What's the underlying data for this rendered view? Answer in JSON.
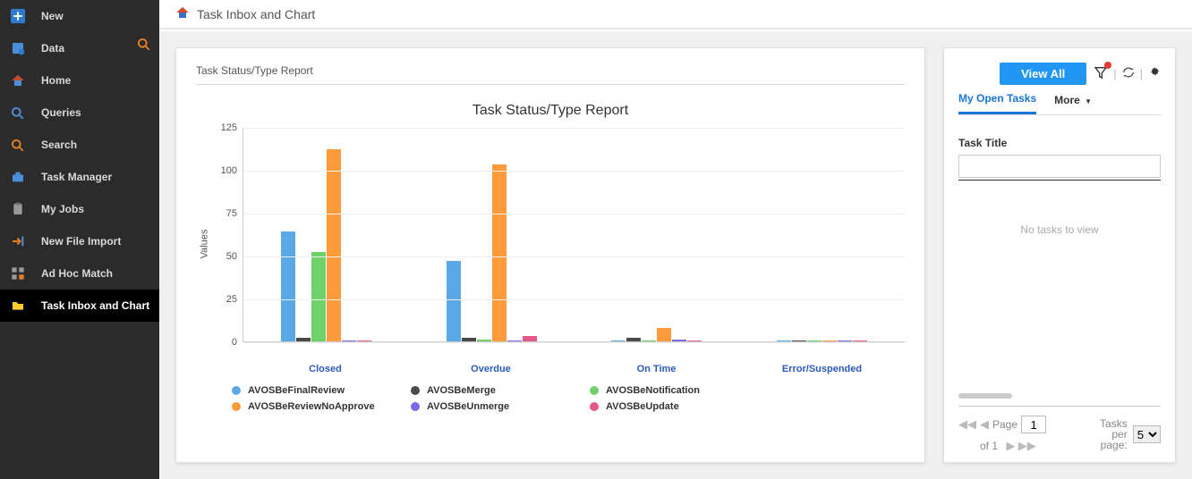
{
  "sidebar": {
    "items": [
      {
        "label": "New",
        "icon": "plus"
      },
      {
        "label": "Data",
        "icon": "data"
      },
      {
        "label": "Home",
        "icon": "home"
      },
      {
        "label": "Queries",
        "icon": "search-blue"
      },
      {
        "label": "Search",
        "icon": "search-orange"
      },
      {
        "label": "Task Manager",
        "icon": "briefcase"
      },
      {
        "label": "My Jobs",
        "icon": "clipboard"
      },
      {
        "label": "New File Import",
        "icon": "import"
      },
      {
        "label": "Ad Hoc Match",
        "icon": "grid"
      },
      {
        "label": "Task Inbox and Chart",
        "icon": "folder",
        "active": true
      }
    ]
  },
  "header": {
    "title": "Task Inbox and Chart"
  },
  "report": {
    "heading": "Task Status/Type Report"
  },
  "right_panel": {
    "view_all": "View All",
    "tab_open": "My Open Tasks",
    "tab_more": "More",
    "task_title_label": "Task Title",
    "no_tasks": "No tasks to view",
    "page_label": "Page",
    "page_value": "1",
    "of_text": "of 1",
    "tasks_per_page_label1": "Tasks per",
    "tasks_per_page_label2": "page:",
    "tasks_per_page_value": "5"
  },
  "chart_data": {
    "type": "bar",
    "title": "Task Status/Type Report",
    "xlabel": "",
    "ylabel": "Values",
    "ylim": [
      0,
      125
    ],
    "yticks": [
      0,
      25,
      50,
      75,
      100,
      125
    ],
    "categories": [
      "Closed",
      "Overdue",
      "On Time",
      "Error/Suspended"
    ],
    "series": [
      {
        "name": "AVOSBeFinalReview",
        "color": "#5aa8e6",
        "values": [
          64,
          47,
          0,
          0
        ]
      },
      {
        "name": "AVOSBeMerge",
        "color": "#4a4a4a",
        "values": [
          2,
          2,
          2,
          0
        ]
      },
      {
        "name": "AVOSBeNotification",
        "color": "#6fd16a",
        "values": [
          52,
          1,
          0,
          0
        ]
      },
      {
        "name": "AVOSBeReviewNoApprove",
        "color": "#ff9b3b",
        "values": [
          112,
          103,
          8,
          0
        ]
      },
      {
        "name": "AVOSBeUnmerge",
        "color": "#7a6be6",
        "values": [
          0,
          0,
          1,
          0
        ]
      },
      {
        "name": "AVOSBeUpdate",
        "color": "#e65a8a",
        "values": [
          0,
          3,
          0,
          0
        ]
      }
    ]
  }
}
